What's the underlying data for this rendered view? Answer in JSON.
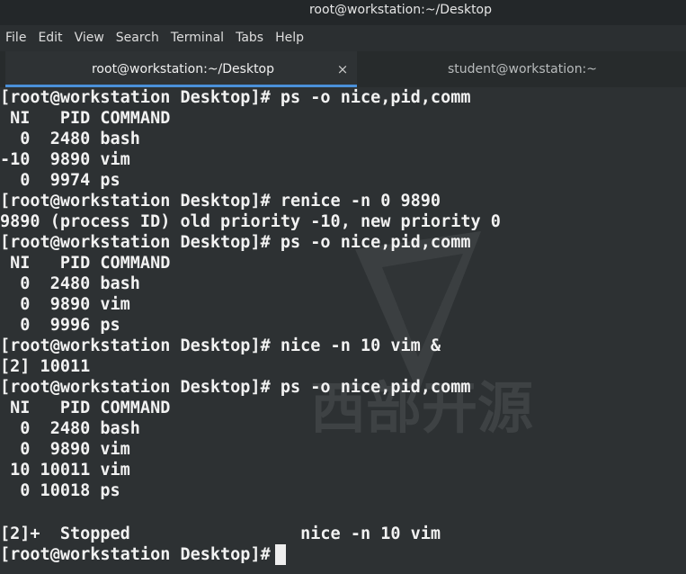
{
  "window": {
    "title": "root@workstation:~/Desktop"
  },
  "menu": {
    "items": [
      "File",
      "Edit",
      "View",
      "Search",
      "Terminal",
      "Tabs",
      "Help"
    ]
  },
  "tabs": [
    {
      "label": "root@workstation:~/Desktop",
      "active": true,
      "close_symbol": "×"
    },
    {
      "label": "student@workstation:~",
      "active": false
    }
  ],
  "terminal": {
    "lines": [
      "[root@workstation Desktop]# ps -o nice,pid,comm",
      " NI   PID COMMAND",
      "  0  2480 bash",
      "-10  9890 vim",
      "  0  9974 ps",
      "[root@workstation Desktop]# renice -n 0 9890",
      "9890 (process ID) old priority -10, new priority 0",
      "[root@workstation Desktop]# ps -o nice,pid,comm",
      " NI   PID COMMAND",
      "  0  2480 bash",
      "  0  9890 vim",
      "  0  9996 ps",
      "[root@workstation Desktop]# nice -n 10 vim &",
      "[2] 10011",
      "[root@workstation Desktop]# ps -o nice,pid,comm",
      " NI   PID COMMAND",
      "  0  2480 bash",
      "  0  9890 vim",
      " 10 10011 vim",
      "  0 10018 ps",
      "",
      "[2]+  Stopped                 nice -n 10 vim",
      "[root@workstation Desktop]# "
    ]
  },
  "watermark": {
    "text": "西部开源"
  },
  "colors": {
    "background": "#2d3133",
    "text": "#f2f2f2",
    "accent": "#4a90d9"
  }
}
